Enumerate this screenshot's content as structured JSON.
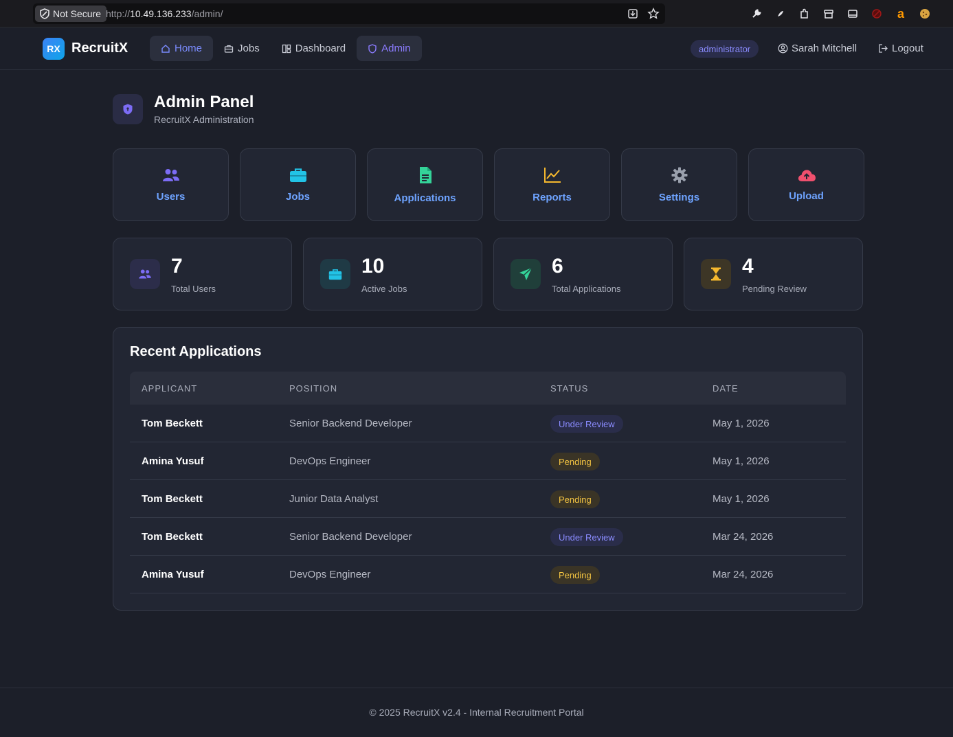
{
  "browser": {
    "not_secure_label": "Not Secure",
    "url_scheme": "http://",
    "url_host": "10.49.136.233",
    "url_path": "/admin/"
  },
  "header": {
    "logo_badge": "RX",
    "app_name": "RecruitX",
    "nav": [
      {
        "label": "Home",
        "icon": "home-icon"
      },
      {
        "label": "Jobs",
        "icon": "briefcase-icon"
      },
      {
        "label": "Dashboard",
        "icon": "dashboard-icon"
      },
      {
        "label": "Admin",
        "icon": "shield-icon"
      }
    ],
    "role": "administrator",
    "user": "Sarah Mitchell",
    "logout": "Logout"
  },
  "page": {
    "title": "Admin Panel",
    "subtitle": "RecruitX Administration"
  },
  "tiles": [
    {
      "label": "Users",
      "icon": "users-icon",
      "color": "#7c6cf5"
    },
    {
      "label": "Jobs",
      "icon": "briefcase-icon",
      "color": "#22c3e6"
    },
    {
      "label": "Applications",
      "icon": "document-icon",
      "color": "#34d399"
    },
    {
      "label": "Reports",
      "icon": "chart-line-icon",
      "color": "#f5b82e"
    },
    {
      "label": "Settings",
      "icon": "gear-icon",
      "color": "#9aa0ad"
    },
    {
      "label": "Upload",
      "icon": "cloud-upload-icon",
      "color": "#f0506e"
    }
  ],
  "stats": [
    {
      "value": "7",
      "caption": "Total Users",
      "icon": "users-icon",
      "color": "#7c6cf5",
      "bg": "#2c2d4a"
    },
    {
      "value": "10",
      "caption": "Active Jobs",
      "icon": "briefcase-icon",
      "color": "#22c3e6",
      "bg": "#1f3a45"
    },
    {
      "value": "6",
      "caption": "Total Applications",
      "icon": "send-icon",
      "color": "#34d399",
      "bg": "#203f3a"
    },
    {
      "value": "4",
      "caption": "Pending Review",
      "icon": "hourglass-icon",
      "color": "#f5b82e",
      "bg": "#3d3626"
    }
  ],
  "recent": {
    "title": "Recent Applications",
    "headers": [
      "APPLICANT",
      "POSITION",
      "STATUS",
      "DATE"
    ],
    "rows": [
      {
        "applicant": "Tom Beckett",
        "position": "Senior Backend Developer",
        "status": "Under Review",
        "date": "May 1, 2026"
      },
      {
        "applicant": "Amina Yusuf",
        "position": "DevOps Engineer",
        "status": "Pending",
        "date": "May 1, 2026"
      },
      {
        "applicant": "Tom Beckett",
        "position": "Junior Data Analyst",
        "status": "Pending",
        "date": "May 1, 2026"
      },
      {
        "applicant": "Tom Beckett",
        "position": "Senior Backend Developer",
        "status": "Under Review",
        "date": "Mar 24, 2026"
      },
      {
        "applicant": "Amina Yusuf",
        "position": "DevOps Engineer",
        "status": "Pending",
        "date": "Mar 24, 2026"
      }
    ]
  },
  "footer": {
    "text": "© 2025 RecruitX v2.4 - Internal Recruitment Portal"
  }
}
